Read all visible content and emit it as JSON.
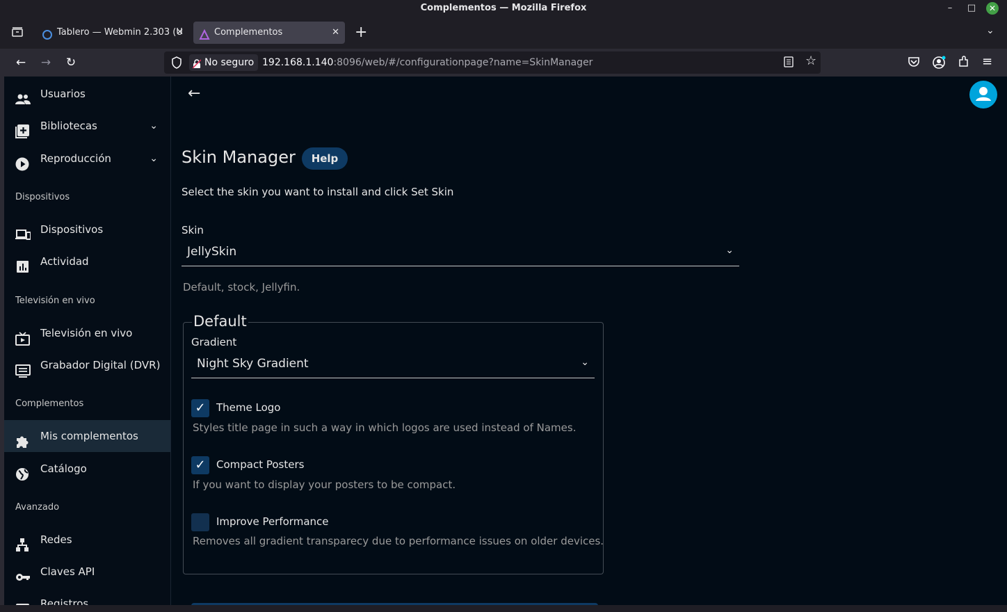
{
  "window": {
    "title": "Complementos — Mozilla Firefox"
  },
  "tabs": [
    {
      "label": "Tablero — Webmin 2.303 (U",
      "active": false
    },
    {
      "label": "Complementos",
      "active": true
    }
  ],
  "urlbar": {
    "security_label": "No seguro",
    "host": "192.168.1.140",
    "path": ":8096/web/#/configurationpage?name=SkinManager"
  },
  "sidebar": {
    "top_items": [
      {
        "label": "Usuarios",
        "icon": "users-icon"
      },
      {
        "label": "Bibliotecas",
        "icon": "library-add-icon",
        "expandable": true
      },
      {
        "label": "Reproducción",
        "icon": "play-circle-icon",
        "expandable": true
      }
    ],
    "sections": [
      {
        "heading": "Dispositivos",
        "items": [
          {
            "label": "Dispositivos",
            "icon": "devices-icon"
          },
          {
            "label": "Actividad",
            "icon": "activity-chart-icon"
          }
        ]
      },
      {
        "heading": "Televisión en vivo",
        "items": [
          {
            "label": "Televisión en vivo",
            "icon": "live-tv-icon"
          },
          {
            "label": "Grabador Digital (DVR)",
            "icon": "dvr-icon"
          }
        ]
      },
      {
        "heading": "Complementos",
        "items": [
          {
            "label": "Mis complementos",
            "icon": "puzzle-icon",
            "active": true
          },
          {
            "label": "Catálogo",
            "icon": "globe-icon"
          }
        ]
      },
      {
        "heading": "Avanzado",
        "items": [
          {
            "label": "Redes",
            "icon": "network-icon"
          },
          {
            "label": "Claves API",
            "icon": "key-icon"
          },
          {
            "label": "Registros",
            "icon": "logs-icon"
          }
        ]
      }
    ]
  },
  "main": {
    "title": "Skin Manager",
    "help_label": "Help",
    "intro": "Select the skin you want to install and click Set Skin",
    "skin_label": "Skin",
    "skin_value": "JellySkin",
    "skin_description": "Default, stock, Jellyfin.",
    "group": {
      "legend": "Default",
      "gradient_label": "Gradient",
      "gradient_value": "Night Sky Gradient",
      "options": [
        {
          "label": "Theme Logo",
          "description": "Styles title page in such a way in which logos are used instead of Names.",
          "checked": true
        },
        {
          "label": "Compact Posters",
          "description": "If you want to display your posters to be compact.",
          "checked": true
        },
        {
          "label": "Improve Performance",
          "description": "Removes all gradient transparecy due to performance issues on older devices.",
          "checked": false
        }
      ]
    }
  },
  "colors": {
    "accent": "#00a4dc",
    "button": "#0e3a63",
    "background": "#020c16"
  }
}
